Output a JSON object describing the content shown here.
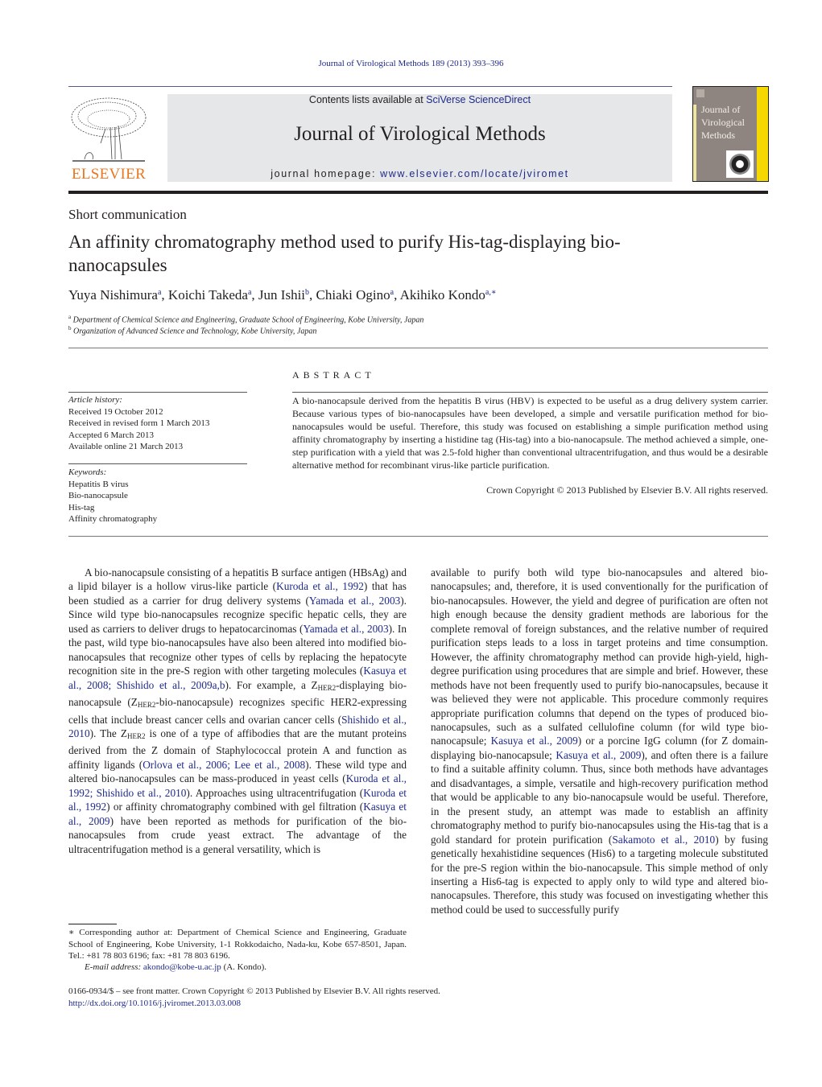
{
  "citation": "Journal of Virological Methods 189 (2013) 393–396",
  "header": {
    "publisher": "ELSEVIER",
    "contents_prefix": "Contents lists available at ",
    "contents_link": "SciVerse ScienceDirect",
    "journal_title": "Journal of Virological Methods",
    "homepage_prefix": "journal homepage: ",
    "homepage_link": "www.elsevier.com/locate/jviromet",
    "cover_title_lines": [
      "Journal of",
      "Virological",
      "Methods"
    ]
  },
  "colors": {
    "link": "#1f2a8a",
    "elsevier_orange": "#e87722",
    "header_band": "#e6e7e8",
    "cover_gray": "#8e8580",
    "cover_yellow": "#f5d800"
  },
  "article": {
    "type": "Short communication",
    "title": "An affinity chromatography method used to purify His-tag-displaying bio-nanocapsules",
    "authors": [
      {
        "name": "Yuya Nishimura",
        "sup": "a"
      },
      {
        "name": "Koichi Takeda",
        "sup": "a"
      },
      {
        "name": "Jun Ishii",
        "sup": "b"
      },
      {
        "name": "Chiaki Ogino",
        "sup": "a"
      },
      {
        "name": "Akihiko Kondo",
        "sup": "a,∗"
      }
    ],
    "affiliations": [
      {
        "label": "a",
        "text": "Department of Chemical Science and Engineering, Graduate School of Engineering, Kobe University, Japan"
      },
      {
        "label": "b",
        "text": "Organization of Advanced Science and Technology, Kobe University, Japan"
      }
    ]
  },
  "info": {
    "history_heading": "Article history:",
    "history": [
      "Received 19 October 2012",
      "Received in revised form 1 March 2013",
      "Accepted 6 March 2013",
      "Available online 21 March 2013"
    ],
    "keywords_heading": "Keywords:",
    "keywords": [
      "Hepatitis B virus",
      "Bio-nanocapsule",
      "His-tag",
      "Affinity chromatography"
    ]
  },
  "abstract": {
    "heading": "ABSTRACT",
    "text": "A bio-nanocapsule derived from the hepatitis B virus (HBV) is expected to be useful as a drug delivery system carrier. Because various types of bio-nanocapsules have been developed, a simple and versatile purification method for bio-nanocapsules would be useful. Therefore, this study was focused on establishing a simple purification method using affinity chromatography by inserting a histidine tag (His-tag) into a bio-nanocapsule. The method achieved a simple, one-step purification with a yield that was 2.5-fold higher than conventional ultracentrifugation, and thus would be a desirable alternative method for recombinant virus-like particle purification.",
    "copyright": "Crown Copyright © 2013 Published by Elsevier B.V. All rights reserved."
  },
  "body": {
    "left": [
      {
        "t": "A bio-nanocapsule consisting of a hepatitis B surface antigen (HBsAg) and a lipid bilayer is a hollow virus-like particle ("
      },
      {
        "l": "Kuroda et al., 1992"
      },
      {
        "t": ") that has been studied as a carrier for drug delivery systems ("
      },
      {
        "l": "Yamada et al., 2003"
      },
      {
        "t": "). Since wild type bio-nanocapsules recognize specific hepatic cells, they are used as carriers to deliver drugs to hepatocarcinomas ("
      },
      {
        "l": "Yamada et al., 2003"
      },
      {
        "t": "). In the past, wild type bio-nanocapsules have also been altered into modified bio-nanocapsules that recognize other types of cells by replacing the hepatocyte recognition site in the pre-S region with other targeting molecules ("
      },
      {
        "l": "Kasuya et al., 2008; Shishido et al., 2009a,b"
      },
      {
        "t": "). For example, a Z"
      },
      {
        "s": "HER2"
      },
      {
        "t": "-displaying bio-nanocapsule (Z"
      },
      {
        "s": "HER2"
      },
      {
        "t": "-bio-nanocapsule) recognizes specific HER2-expressing cells that include breast cancer cells and ovarian cancer cells ("
      },
      {
        "l": "Shishido et al., 2010"
      },
      {
        "t": "). The Z"
      },
      {
        "s": "HER2"
      },
      {
        "t": " is one of a type of affibodies that are the mutant proteins derived from the Z domain of Staphylococcal protein A and function as affinity ligands ("
      },
      {
        "l": "Orlova et al., 2006; Lee et al., 2008"
      },
      {
        "t": "). These wild type and altered bio-nanocapsules can be mass-produced in yeast cells ("
      },
      {
        "l": "Kuroda et al., 1992; Shishido et al., 2010"
      },
      {
        "t": "). Approaches using ultracentrifugation ("
      },
      {
        "l": "Kuroda et al., 1992"
      },
      {
        "t": ") or affinity chromatography combined with gel filtration ("
      },
      {
        "l": "Kasuya et al., 2009"
      },
      {
        "t": ") have been reported as methods for purification of the bio-nanocapsules from crude yeast extract. The advantage of the ultracentrifugation method is a general versatility, which is"
      }
    ],
    "right": [
      {
        "t": "available to purify both wild type bio-nanocapsules and altered bio-nanocapsules; and, therefore, it is used conventionally for the purification of bio-nanocapsules. However, the yield and degree of purification are often not high enough because the density gradient methods are laborious for the complete removal of foreign substances, and the relative number of required purification steps leads to a loss in target proteins and time consumption. However, the affinity chromatography method can provide high-yield, high-degree purification using procedures that are simple and brief. However, these methods have not been frequently used to purify bio-nanocapsules, because it was believed they were not applicable. This procedure commonly requires appropriate purification columns that depend on the types of produced bio-nanocapsules, such as a sulfated cellulofine column (for wild type bio-nanocapsule; "
      },
      {
        "l": "Kasuya et al., 2009"
      },
      {
        "t": ") or a porcine IgG column (for Z domain-displaying bio-nanocapsule; "
      },
      {
        "l": "Kasuya et al., 2009"
      },
      {
        "t": "), and often there is a failure to find a suitable affinity column. Thus, since both methods have advantages and disadvantages, a simple, versatile and high-recovery purification method that would be applicable to any bio-nanocapsule would be useful. Therefore, in the present study, an attempt was made to establish an affinity chromatography method to purify bio-nanocapsules using the His-tag that is a gold standard for protein purification ("
      },
      {
        "l": "Sakamoto et al., 2010"
      },
      {
        "t": ") by fusing genetically hexahistidine sequences (His6) to a targeting molecule substituted for the pre-S region within the bio-nanocapsule. This simple method of only inserting a His6-tag is expected to apply only to wild type and altered bio-nanocapsules. Therefore, this study was focused on investigating whether this method could be used to successfully purify"
      }
    ]
  },
  "footnote": {
    "corresponding": "∗ Corresponding author at: Department of Chemical Science and Engineering, Graduate School of Engineering, Kobe University, 1-1 Rokkodaicho, Nada-ku, Kobe 657-8501, Japan. Tel.: +81 78 803 6196; fax: +81 78 803 6196.",
    "email_label": "E-mail address:",
    "email": "akondo@kobe-u.ac.jp",
    "email_suffix": " (A. Kondo).",
    "front_matter": "0166-0934/$ – see front matter. Crown Copyright © 2013 Published by Elsevier B.V. All rights reserved.",
    "doi": "http://dx.doi.org/10.1016/j.jviromet.2013.03.008"
  }
}
